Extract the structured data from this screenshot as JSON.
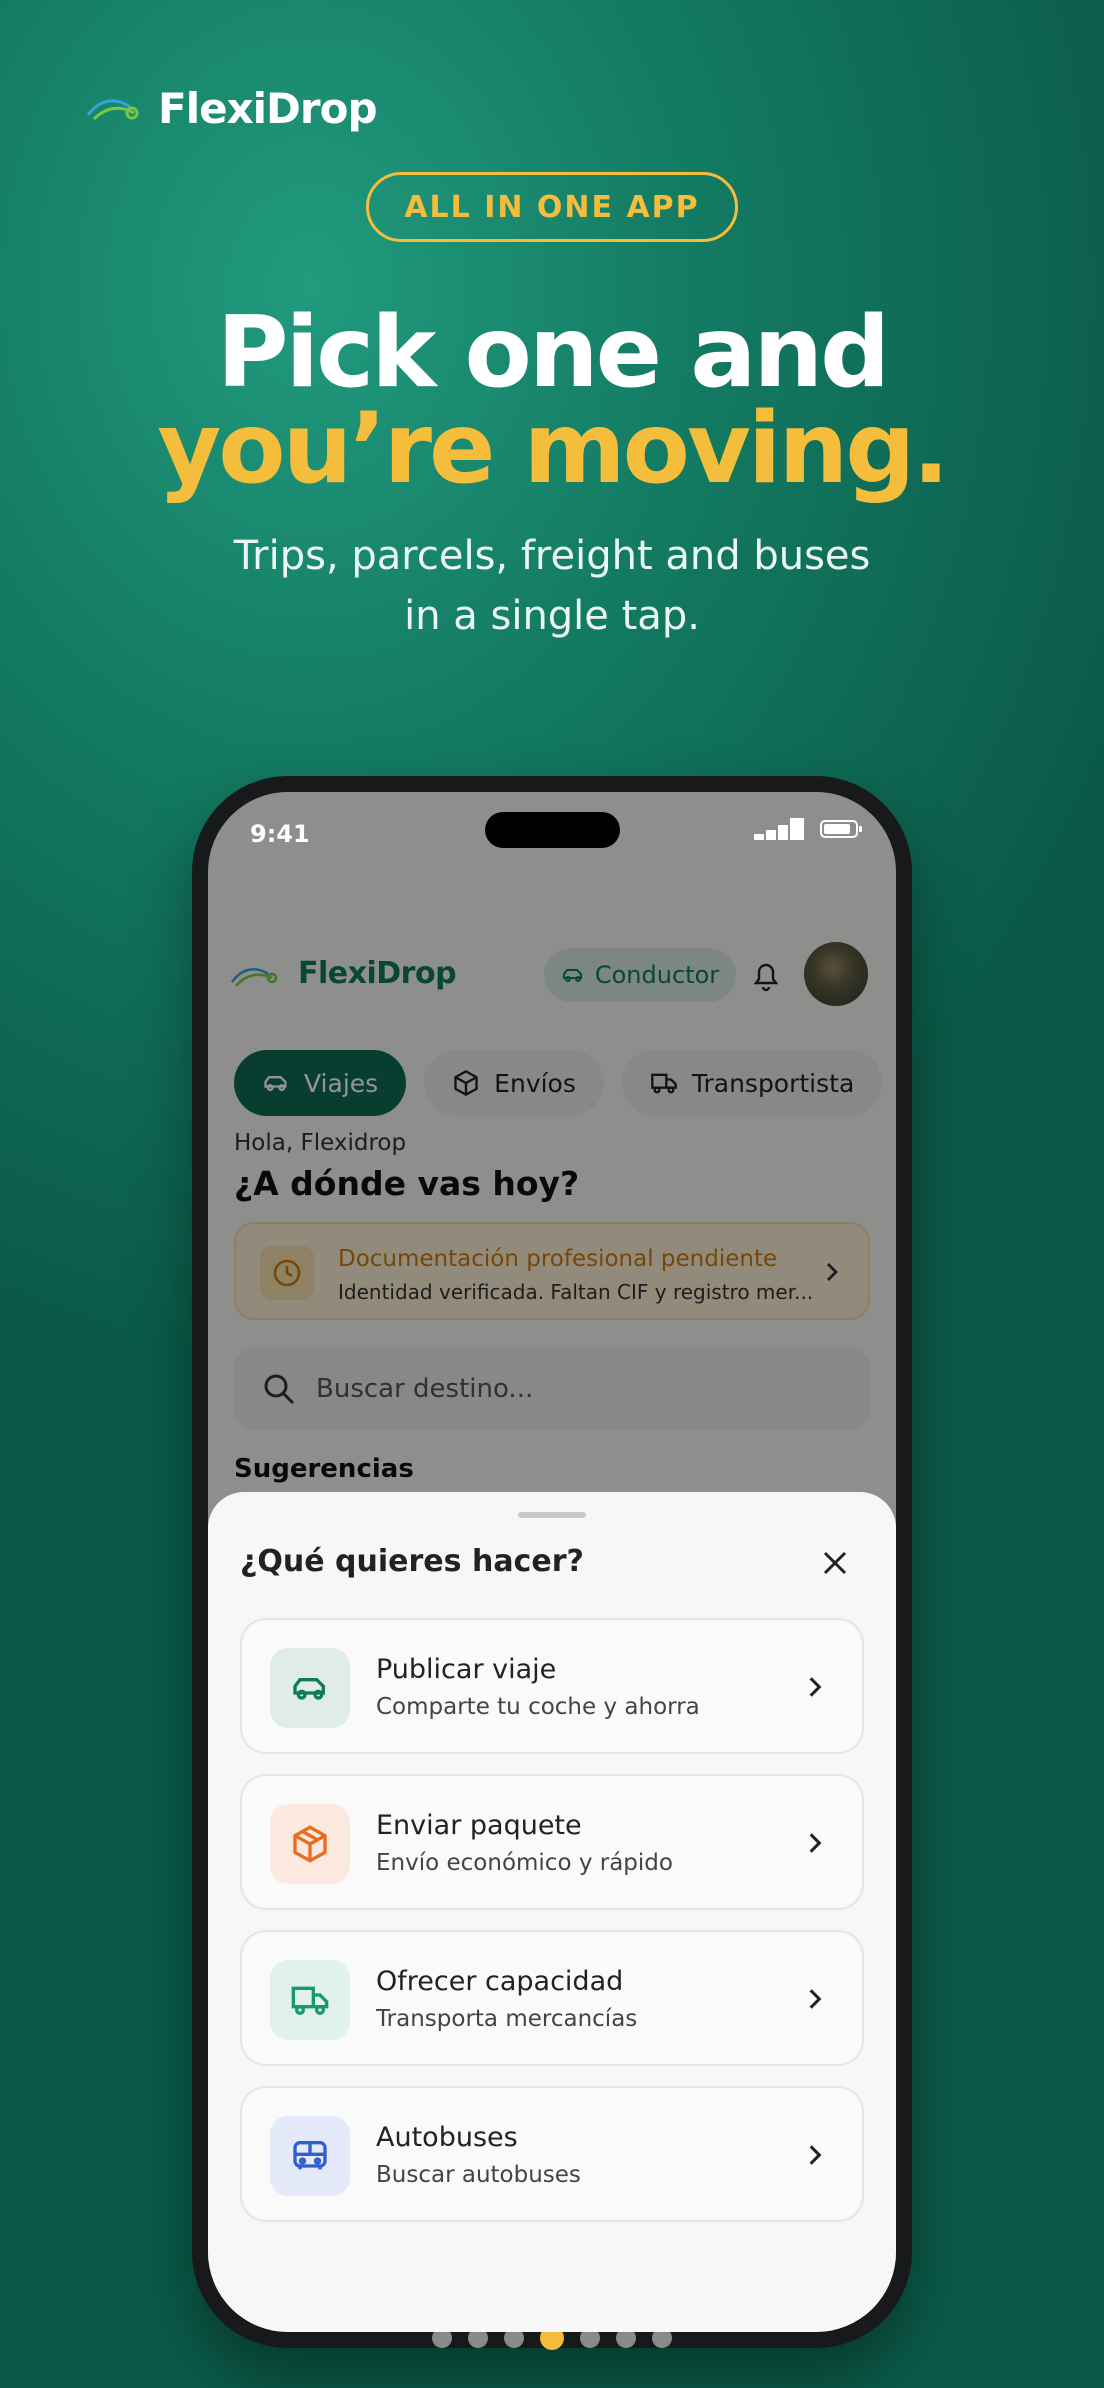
{
  "promo": {
    "brand": "FlexiDrop",
    "pill": "ALL IN ONE APP",
    "headline_line1": "Pick one and",
    "headline_line2": "you’re moving.",
    "subtitle_line1": "Trips, parcels, freight and buses",
    "subtitle_line2": "in a single tap.",
    "accent_color": "#f5bd3c"
  },
  "status_bar": {
    "time": "9:41"
  },
  "app": {
    "name": "FlexiDrop",
    "role_chip": "Conductor",
    "tabs": [
      {
        "label": "Viajes",
        "icon": "car-icon",
        "active": true
      },
      {
        "label": "Envíos",
        "icon": "box-icon",
        "active": false
      },
      {
        "label": "Transportista",
        "icon": "truck-icon",
        "active": false
      }
    ],
    "greeting": "Hola, Flexidrop",
    "question": "¿A dónde vas hoy?",
    "notice": {
      "title": "Documentación profesional pendiente",
      "subtitle": "Identidad verificada. Faltan CIF y registro mer..."
    },
    "search_placeholder": "Buscar destino...",
    "section": "Sugerencias",
    "brand_color": "#0d6b52"
  },
  "sheet": {
    "title": "¿Qué quieres hacer?",
    "options": [
      {
        "title": "Publicar viaje",
        "subtitle": "Comparte tu coche y ahorra",
        "icon": "car-icon",
        "tint": "#dfece8",
        "color": "#0f7a5c"
      },
      {
        "title": "Enviar paquete",
        "subtitle": "Envío económico y rápido",
        "icon": "box-icon",
        "tint": "#fbe9df",
        "color": "#e86d1f"
      },
      {
        "title": "Ofrecer capacidad",
        "subtitle": "Transporta mercancías",
        "icon": "truck-icon",
        "tint": "#e0f2ea",
        "color": "#1a9a6c"
      },
      {
        "title": "Autobuses",
        "subtitle": "Buscar autobuses",
        "icon": "bus-icon",
        "tint": "#e4eaf9",
        "color": "#2f5fd0"
      }
    ]
  },
  "pagination": {
    "count": 7,
    "active_index": 3
  }
}
